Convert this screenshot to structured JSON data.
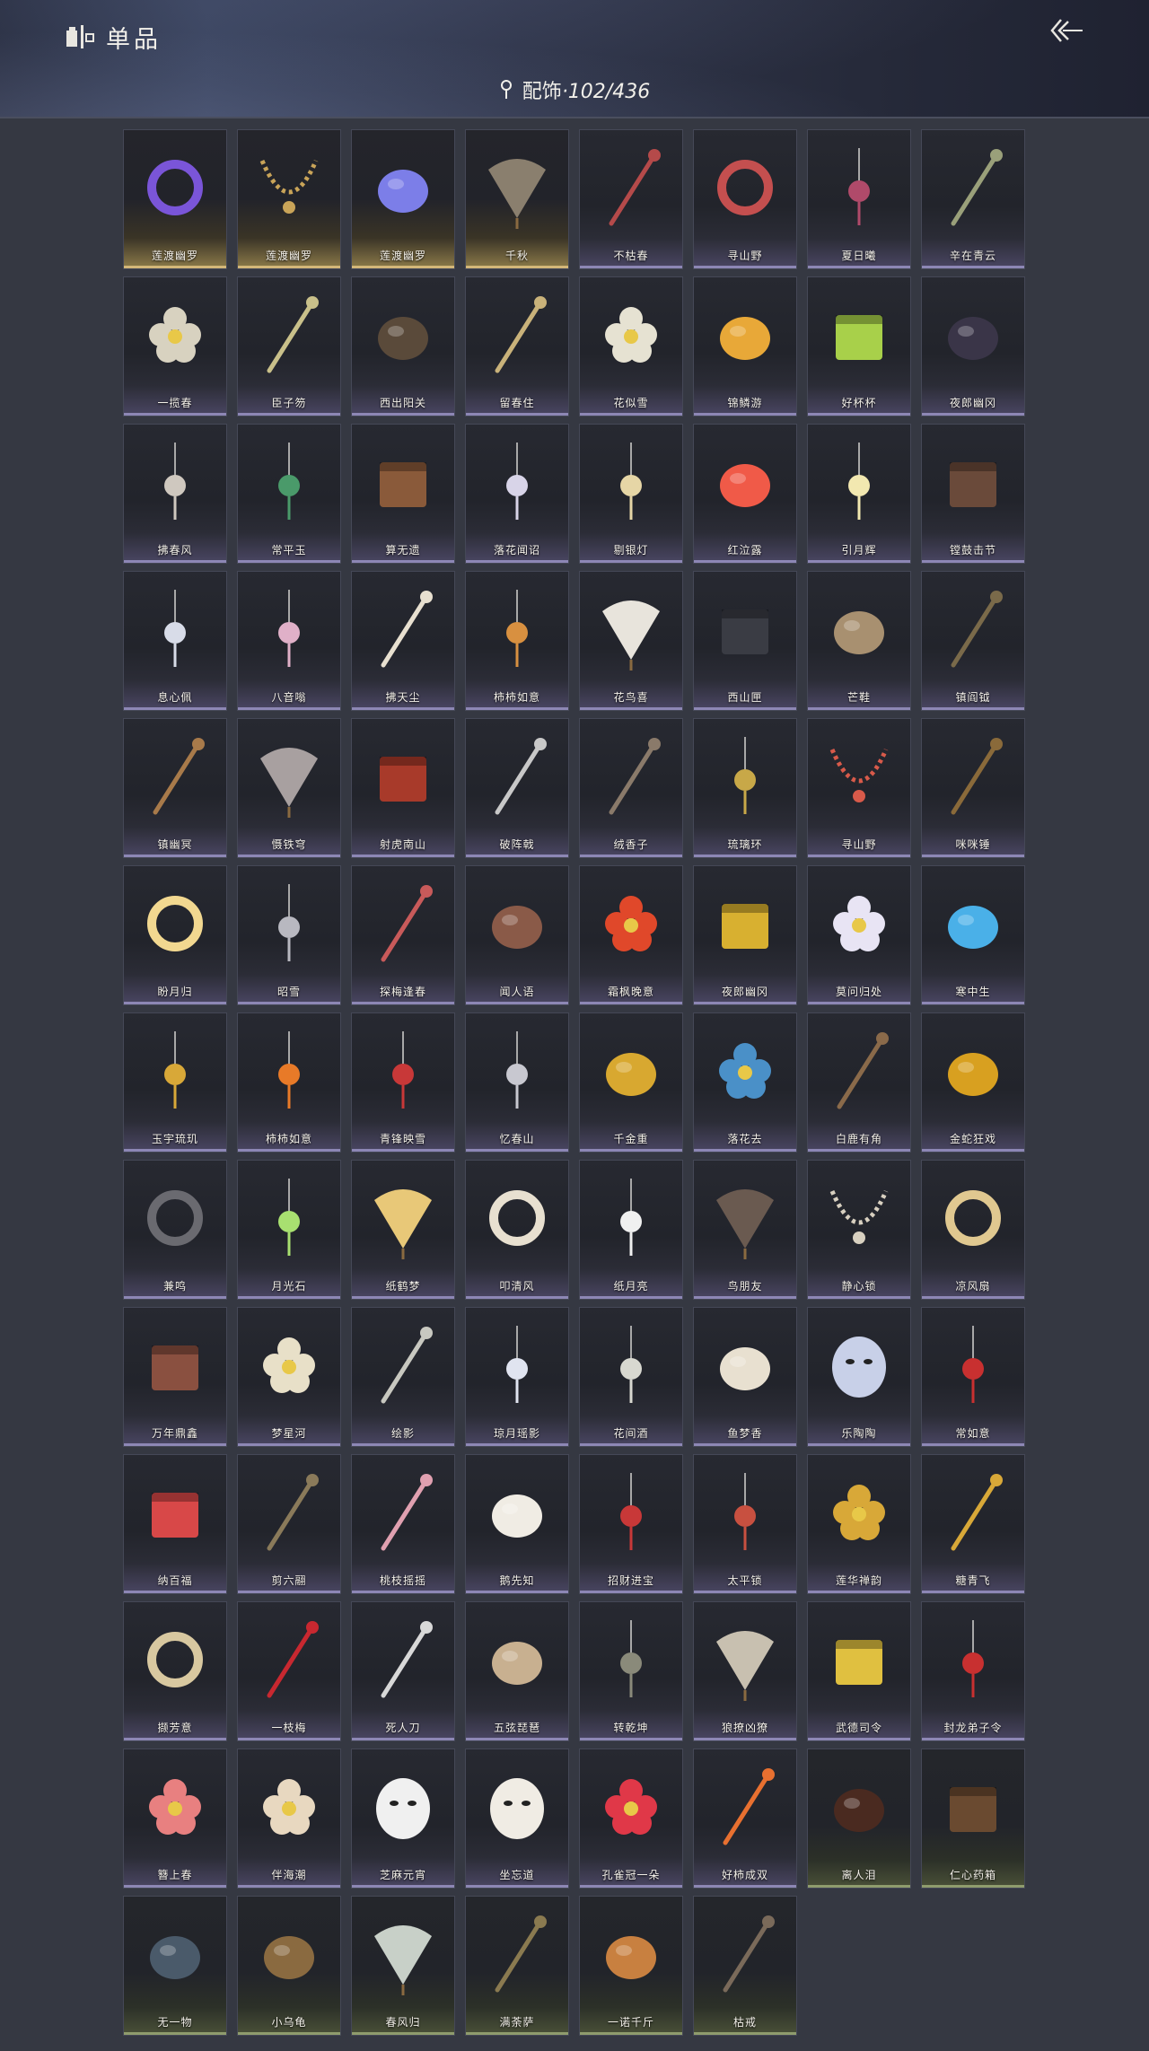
{
  "header": {
    "title": "单品",
    "back_icon": "back-arrow-icon",
    "category_label": "配饰",
    "category_count": "·102/436"
  },
  "items": [
    {
      "name": "莲渡幽罗",
      "tier": "gold",
      "icon": "purple-ring",
      "color": "#7a55d8"
    },
    {
      "name": "莲渡幽罗",
      "tier": "gold",
      "icon": "bead-necklace",
      "color": "#c9a458"
    },
    {
      "name": "莲渡幽罗",
      "tier": "gold",
      "icon": "twin-horns",
      "color": "#7c7ee8"
    },
    {
      "name": "千秋",
      "tier": "gold",
      "icon": "fan-cloth",
      "color": "#8a7f6e"
    },
    {
      "name": "不枯春",
      "tier": "purple",
      "icon": "branch",
      "color": "#b54a4a"
    },
    {
      "name": "寻山野",
      "tier": "purple",
      "icon": "bracelet",
      "color": "#c44f4f"
    },
    {
      "name": "夏日曦",
      "tier": "purple",
      "icon": "hanging-pair",
      "color": "#b04a6a"
    },
    {
      "name": "辛在青云",
      "tier": "purple",
      "icon": "hairpin",
      "color": "#9aa07a"
    },
    {
      "name": "一揽春",
      "tier": "purple",
      "icon": "flower-basket",
      "color": "#d8d2c0"
    },
    {
      "name": "臣子笏",
      "tier": "purple",
      "icon": "tablet",
      "color": "#c9c08a"
    },
    {
      "name": "西出阳关",
      "tier": "purple",
      "icon": "gourd",
      "color": "#5a4a3a"
    },
    {
      "name": "留春住",
      "tier": "purple",
      "icon": "twig",
      "color": "#c9b27a"
    },
    {
      "name": "花似雪",
      "tier": "purple",
      "icon": "white-flower",
      "color": "#e6e2d2"
    },
    {
      "name": "锦鳞游",
      "tier": "purple",
      "icon": "fish",
      "color": "#e8a838"
    },
    {
      "name": "好杯杯",
      "tier": "purple",
      "icon": "green-cup",
      "color": "#a8d04a"
    },
    {
      "name": "夜郎幽冈",
      "tier": "purple",
      "icon": "dark-feather",
      "color": "#3a3548"
    },
    {
      "name": "拂春风",
      "tier": "purple",
      "icon": "ribbon",
      "color": "#cfc8bf"
    },
    {
      "name": "常平玉",
      "tier": "purple",
      "icon": "jade-tassel",
      "color": "#4a9a6a"
    },
    {
      "name": "算无遗",
      "tier": "purple",
      "icon": "abacus",
      "color": "#8a5a3a"
    },
    {
      "name": "落花闻诏",
      "tier": "purple",
      "icon": "pendant-flower",
      "color": "#d8d4e8"
    },
    {
      "name": "剔银灯",
      "tier": "purple",
      "icon": "lantern",
      "color": "#e6d6a6"
    },
    {
      "name": "红泣露",
      "tier": "purple",
      "icon": "red-figure",
      "color": "#f05a48"
    },
    {
      "name": "引月辉",
      "tier": "purple",
      "icon": "mobile-lights",
      "color": "#f2e8b0"
    },
    {
      "name": "镗鼓击节",
      "tier": "purple",
      "icon": "drum",
      "color": "#6a4a3a"
    },
    {
      "name": "息心佩",
      "tier": "purple",
      "icon": "round-pendant",
      "color": "#d8dce8"
    },
    {
      "name": "八音嗡",
      "tier": "purple",
      "icon": "doll-charm",
      "color": "#e0b0c8"
    },
    {
      "name": "拂天尘",
      "tier": "purple",
      "icon": "whisk",
      "color": "#e8e0d0"
    },
    {
      "name": "柿柿如意",
      "tier": "purple",
      "icon": "orange-pendant",
      "color": "#d89040"
    },
    {
      "name": "花鸟喜",
      "tier": "purple",
      "icon": "kite",
      "color": "#e8e4dc"
    },
    {
      "name": "西山匣",
      "tier": "purple",
      "icon": "case",
      "color": "#3a3c44"
    },
    {
      "name": "芒鞋",
      "tier": "purple",
      "icon": "sandals",
      "color": "#a89070"
    },
    {
      "name": "镇阎钺",
      "tier": "purple",
      "icon": "rod",
      "color": "#7a6a4a"
    },
    {
      "name": "镇幽冥",
      "tier": "purple",
      "icon": "ruyi",
      "color": "#a87a4a"
    },
    {
      "name": "慑铁穹",
      "tier": "purple",
      "icon": "flag-spear",
      "color": "#a8a0a0"
    },
    {
      "name": "射虎南山",
      "tier": "purple",
      "icon": "red-banner",
      "color": "#a83a2a"
    },
    {
      "name": "破阵戟",
      "tier": "purple",
      "icon": "halberd",
      "color": "#c8c8c8"
    },
    {
      "name": "绒香子",
      "tier": "purple",
      "icon": "thin-stick",
      "color": "#8a7a6a"
    },
    {
      "name": "琉璃环",
      "tier": "purple",
      "icon": "ring-tassel",
      "color": "#c8a848"
    },
    {
      "name": "寻山野",
      "tier": "purple",
      "icon": "multi-necklace",
      "color": "#d85a4a"
    },
    {
      "name": "咪咪锤",
      "tier": "purple",
      "icon": "hammer",
      "color": "#8a6a3a"
    },
    {
      "name": "盼月归",
      "tier": "purple",
      "icon": "moon-disc",
      "color": "#f2d890"
    },
    {
      "name": "昭雪",
      "tier": "purple",
      "icon": "hanging-chains",
      "color": "#b8b8c0"
    },
    {
      "name": "探梅逢春",
      "tier": "purple",
      "icon": "branch-ornament",
      "color": "#c85a5a"
    },
    {
      "name": "闻人语",
      "tier": "purple",
      "icon": "ear-pair",
      "color": "#8a5a48"
    },
    {
      "name": "霜枫晚意",
      "tier": "purple",
      "icon": "maple-leaf",
      "color": "#e0482a"
    },
    {
      "name": "夜郎幽冈",
      "tier": "purple",
      "icon": "gold-crown",
      "color": "#d8b030"
    },
    {
      "name": "莫问归处",
      "tier": "purple",
      "icon": "blossom-pin",
      "color": "#e8e4f4"
    },
    {
      "name": "寒中生",
      "tier": "purple",
      "icon": "blue-mushroom",
      "color": "#4ab0e8"
    },
    {
      "name": "玉宇琉玑",
      "tier": "purple",
      "icon": "gold-gourd-charm",
      "color": "#d8a838"
    },
    {
      "name": "柿柿如意",
      "tier": "purple",
      "icon": "persimmon-tassel",
      "color": "#e87a28"
    },
    {
      "name": "青锋映雪",
      "tier": "purple",
      "icon": "red-tassel",
      "color": "#c83838"
    },
    {
      "name": "忆春山",
      "tier": "purple",
      "icon": "disc-chain",
      "color": "#c8c8d0"
    },
    {
      "name": "千金重",
      "tier": "purple",
      "icon": "gold-toad",
      "color": "#d8a830"
    },
    {
      "name": "落花去",
      "tier": "purple",
      "icon": "blue-flower",
      "color": "#4a90c8"
    },
    {
      "name": "白鹿有角",
      "tier": "purple",
      "icon": "antler",
      "color": "#8a6a4a"
    },
    {
      "name": "金蛇狂戏",
      "tier": "purple",
      "icon": "gold-snake",
      "color": "#d8a020"
    },
    {
      "name": "兼鸣",
      "tier": "purple",
      "icon": "dark-badge",
      "color": "#6a6a70"
    },
    {
      "name": "月光石",
      "tier": "purple",
      "icon": "green-gem",
      "color": "#a8e070"
    },
    {
      "name": "纸鹤梦",
      "tier": "purple",
      "icon": "paper-crane",
      "color": "#e8c878"
    },
    {
      "name": "叩清风",
      "tier": "purple",
      "icon": "round-fan",
      "color": "#e8e0d0"
    },
    {
      "name": "纸月亮",
      "tier": "purple",
      "icon": "paper-moon",
      "color": "#f0f0f0"
    },
    {
      "name": "鸟朋友",
      "tier": "purple",
      "icon": "bird-hat",
      "color": "#6a5a50"
    },
    {
      "name": "静心锁",
      "tier": "purple",
      "icon": "bead-loop",
      "color": "#d8d0c0"
    },
    {
      "name": "凉风扇",
      "tier": "purple",
      "icon": "round-fan-2",
      "color": "#e0c890"
    },
    {
      "name": "万年鼎鑫",
      "tier": "purple",
      "icon": "cauldron",
      "color": "#8a5040"
    },
    {
      "name": "梦星河",
      "tier": "purple",
      "icon": "boat-blossom",
      "color": "#e8e0c8"
    },
    {
      "name": "绘影",
      "tier": "purple",
      "icon": "brush-pair",
      "color": "#c8c8c0"
    },
    {
      "name": "琼月瑶影",
      "tier": "purple",
      "icon": "crescent",
      "color": "#e0e4f0"
    },
    {
      "name": "花间酒",
      "tier": "purple",
      "icon": "wine-gourd",
      "color": "#d8d8d0"
    },
    {
      "name": "鱼梦香",
      "tier": "purple",
      "icon": "white-pouch",
      "color": "#e8e0d0"
    },
    {
      "name": "乐陶陶",
      "tier": "purple",
      "icon": "figurine",
      "color": "#c8d0e8"
    },
    {
      "name": "常如意",
      "tier": "purple",
      "icon": "red-knot",
      "color": "#c83030"
    },
    {
      "name": "纳百福",
      "tier": "purple",
      "icon": "festive-bag",
      "color": "#d84848"
    },
    {
      "name": "剪六翮",
      "tier": "purple",
      "icon": "dagger",
      "color": "#8a7a5a"
    },
    {
      "name": "桃枝摇摇",
      "tier": "purple",
      "icon": "peach-pin",
      "color": "#e0a0b0"
    },
    {
      "name": "鹅先知",
      "tier": "purple",
      "icon": "goose",
      "color": "#f0ece4"
    },
    {
      "name": "招财进宝",
      "tier": "purple",
      "icon": "red-charm",
      "color": "#c83838"
    },
    {
      "name": "太平锁",
      "tier": "purple",
      "icon": "lock-tassel",
      "color": "#c85040"
    },
    {
      "name": "莲华禅韵",
      "tier": "purple",
      "icon": "gold-lotus",
      "color": "#d8a838"
    },
    {
      "name": "糖青飞",
      "tier": "purple",
      "icon": "gold-staff",
      "color": "#d8a838"
    },
    {
      "name": "撷芳意",
      "tier": "purple",
      "icon": "flower-wreath",
      "color": "#d8c8a0"
    },
    {
      "name": "一枝梅",
      "tier": "purple",
      "icon": "plum-branch",
      "color": "#c82830"
    },
    {
      "name": "死人刀",
      "tier": "purple",
      "icon": "blade",
      "color": "#d8d8d8"
    },
    {
      "name": "五弦琵琶",
      "tier": "purple",
      "icon": "pipa",
      "color": "#c8b090"
    },
    {
      "name": "转乾坤",
      "tier": "purple",
      "icon": "small-charm",
      "color": "#8a8a7a"
    },
    {
      "name": "狼撩凶獠",
      "tier": "purple",
      "icon": "claw",
      "color": "#c8c0b0"
    },
    {
      "name": "武德司令",
      "tier": "purple",
      "icon": "gold-token",
      "color": "#e0c040"
    },
    {
      "name": "封龙弟子令",
      "tier": "purple",
      "icon": "red-token",
      "color": "#c83030"
    },
    {
      "name": "簪上春",
      "tier": "purple",
      "icon": "pink-rose",
      "color": "#e88080"
    },
    {
      "name": "伴海潮",
      "tier": "purple",
      "icon": "starfish",
      "color": "#e8d8c0"
    },
    {
      "name": "芝麻元宵",
      "tier": "purple",
      "icon": "panda-mask",
      "color": "#f0f0f0"
    },
    {
      "name": "坐忘道",
      "tier": "purple",
      "icon": "white-mask",
      "color": "#f0ece4"
    },
    {
      "name": "孔雀冠一朵",
      "tier": "purple",
      "icon": "red-bloom",
      "color": "#e03848"
    },
    {
      "name": "好柿成双",
      "tier": "purple",
      "icon": "persimmon-pin",
      "color": "#e87030"
    },
    {
      "name": "离人泪",
      "tier": "green",
      "icon": "dark-vase",
      "color": "#4a2a20"
    },
    {
      "name": "仁心药箱",
      "tier": "green",
      "icon": "medicine-box",
      "color": "#6a4a30"
    },
    {
      "name": "无一物",
      "tier": "green",
      "icon": "cloth-pouch",
      "color": "#4a5a6a"
    },
    {
      "name": "小乌龟",
      "tier": "green",
      "icon": "turtle",
      "color": "#8a6a40"
    },
    {
      "name": "春风归",
      "tier": "green",
      "icon": "swallow-kite",
      "color": "#c8d0c8"
    },
    {
      "name": "满荼萨",
      "tier": "green",
      "icon": "arrow-bundle",
      "color": "#8a7a50"
    },
    {
      "name": "一诺千斤",
      "tier": "green",
      "icon": "roast-chicken",
      "color": "#c88040"
    },
    {
      "name": "枯戒",
      "tier": "green",
      "icon": "dry-branch",
      "color": "#7a6a5a"
    }
  ]
}
